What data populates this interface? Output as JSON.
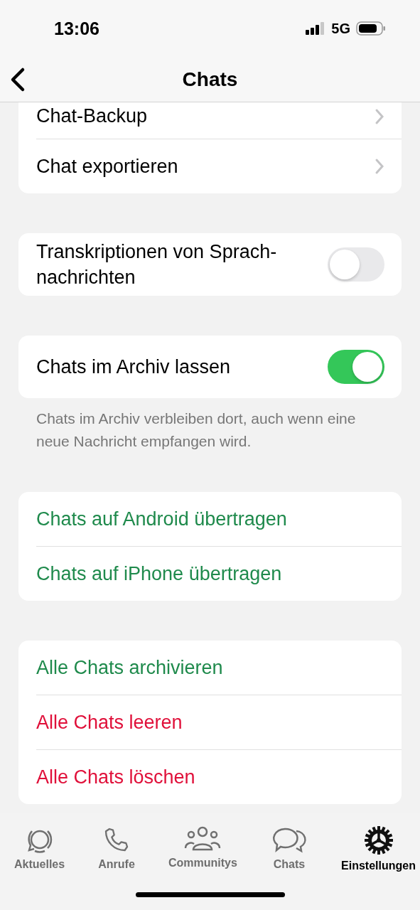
{
  "status_bar": {
    "time": "13:06",
    "network": "5G"
  },
  "nav": {
    "title": "Chats"
  },
  "sections": [
    {
      "rows": [
        {
          "kind": "link",
          "label": "Chat-Backup"
        },
        {
          "kind": "link",
          "label": "Chat exportieren"
        }
      ]
    },
    {
      "rows": [
        {
          "kind": "toggle",
          "label": "Transkriptionen von Sprach-nachrichten",
          "on": false
        }
      ]
    },
    {
      "rows": [
        {
          "kind": "toggle",
          "label": "Chats im Archiv lassen",
          "on": true
        }
      ],
      "footer": "Chats im Archiv verbleiben dort, auch wenn eine neue Nachricht empfangen wird."
    },
    {
      "rows": [
        {
          "kind": "action",
          "label": "Chats auf Android übertragen",
          "color": "#1f8a4c"
        },
        {
          "kind": "action",
          "label": "Chats auf iPhone übertragen",
          "color": "#1f8a4c"
        }
      ]
    },
    {
      "rows": [
        {
          "kind": "action",
          "label": "Alle Chats archivieren",
          "color": "#1f8a4c"
        },
        {
          "kind": "action",
          "label": "Alle Chats leeren",
          "color": "#e0103a"
        },
        {
          "kind": "action",
          "label": "Alle Chats löschen",
          "color": "#e0103a"
        }
      ]
    }
  ],
  "tabs": [
    {
      "kind": "status",
      "label": "Aktuelles",
      "selected": false
    },
    {
      "kind": "phone",
      "label": "Anrufe",
      "selected": false
    },
    {
      "kind": "people",
      "label": "Communitys",
      "selected": false
    },
    {
      "kind": "chats",
      "label": "Chats",
      "selected": false
    },
    {
      "kind": "gear",
      "label": "Einstellungen",
      "selected": true
    }
  ]
}
